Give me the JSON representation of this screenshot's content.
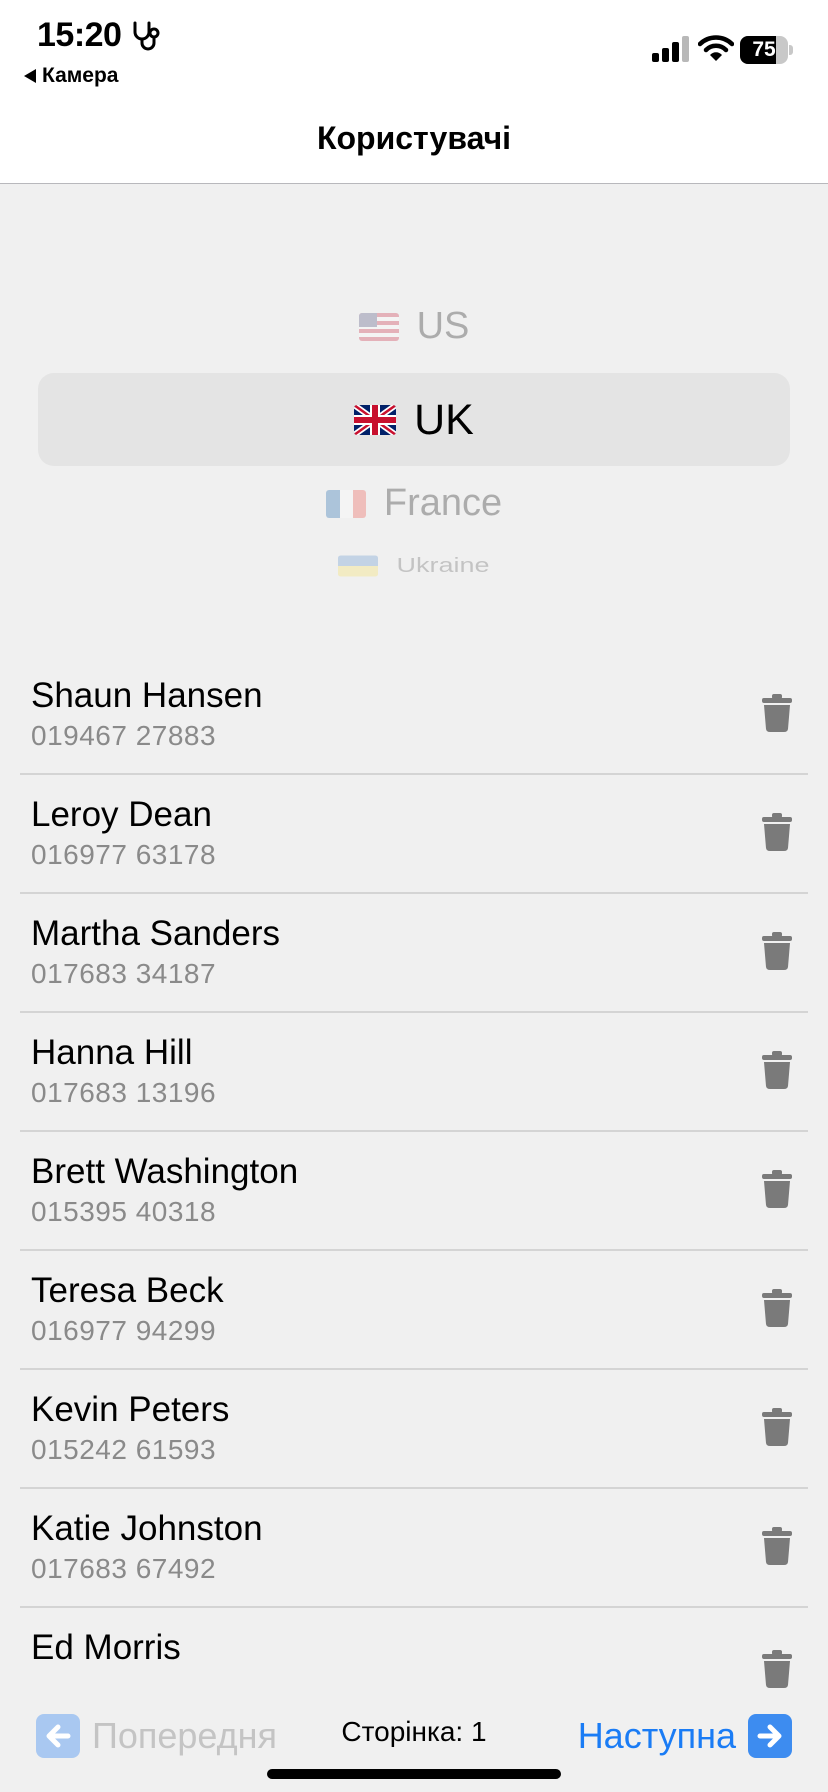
{
  "status_bar": {
    "time": "15:20",
    "back_app": "Камера",
    "battery_percent": "75",
    "battery_level": 0.75,
    "icons": [
      "stethoscope-icon",
      "cellular-signal-icon",
      "wifi-icon",
      "battery-icon"
    ]
  },
  "nav": {
    "title": "Користувачі"
  },
  "picker": {
    "options": [
      {
        "label": "US",
        "flag": "flag-us-icon"
      },
      {
        "label": "UK",
        "flag": "flag-uk-icon"
      },
      {
        "label": "France",
        "flag": "flag-fr-icon"
      },
      {
        "label": "Ukraine",
        "flag": "flag-ua-icon"
      }
    ],
    "selected": "UK"
  },
  "users": [
    {
      "name": "Shaun Hansen",
      "phone": "019467 27883"
    },
    {
      "name": "Leroy Dean",
      "phone": "016977 63178"
    },
    {
      "name": "Martha Sanders",
      "phone": "017683 34187"
    },
    {
      "name": "Hanna Hill",
      "phone": "017683 13196"
    },
    {
      "name": "Brett Washington",
      "phone": "015395 40318"
    },
    {
      "name": "Teresa Beck",
      "phone": "016977 94299"
    },
    {
      "name": "Kevin Peters",
      "phone": "015242 61593"
    },
    {
      "name": "Katie Johnston",
      "phone": "017683 67492"
    },
    {
      "name": "Ed Morris",
      "phone": ""
    }
  ],
  "pager": {
    "prev_label": "Попередня",
    "page_label": "Сторінка: 1",
    "next_label": "Наступна"
  },
  "colors": {
    "accent": "#1a7cf5",
    "disabled": "#c4c4c4",
    "background": "#f0f0f0",
    "secondary_text": "#8a8a8a",
    "trash_icon": "#7a7a7a"
  }
}
